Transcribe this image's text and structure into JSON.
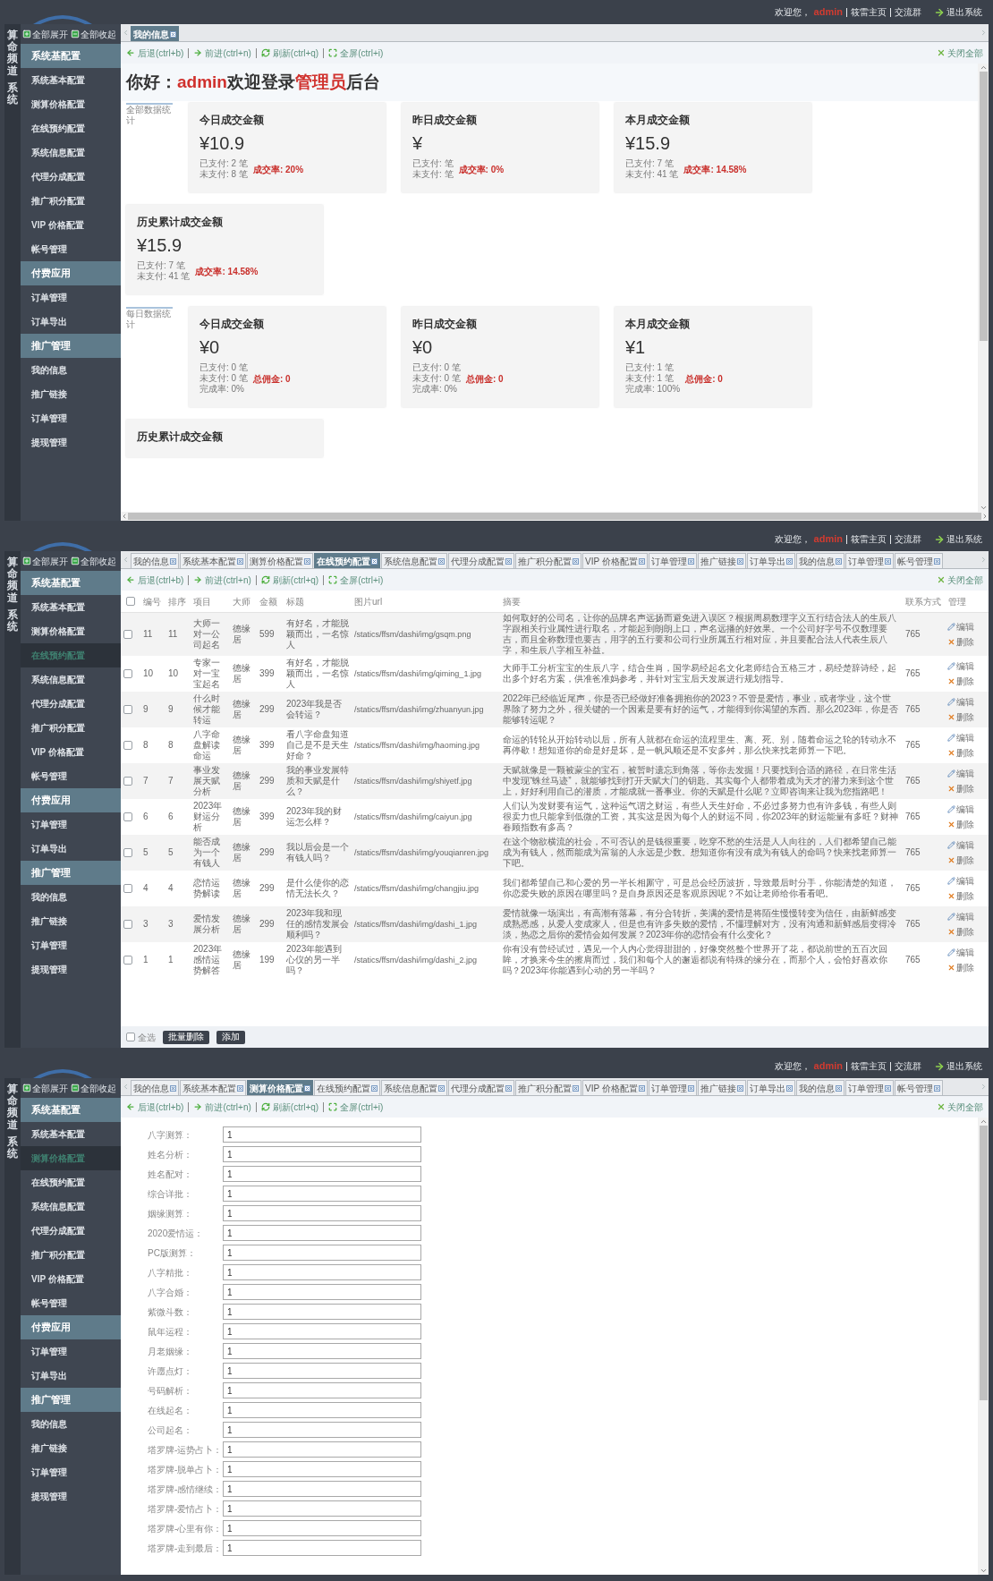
{
  "panels": [
    {
      "header": {
        "welcome": "欢迎您，",
        "user": "admin",
        "links": [
          "筱雷主页",
          "交流群"
        ],
        "logout": "退出系统"
      },
      "brand": [
        "算命频道",
        "系统"
      ],
      "tree_controls": [
        {
          "kind": "expand",
          "label": "全部展开"
        },
        {
          "kind": "collapse",
          "label": "全部收起"
        }
      ],
      "sidebar": [
        {
          "label": "系统基配置",
          "children": [
            {
              "label": "系统基本配置",
              "selected": false
            },
            {
              "label": "测算价格配置",
              "selected": false
            },
            {
              "label": "在线预约配置",
              "selected": false
            },
            {
              "label": "系统信息配置",
              "selected": false
            },
            {
              "label": "代理分成配置",
              "selected": false
            },
            {
              "label": "推广积分配置",
              "selected": false
            },
            {
              "label": "VIP 价格配置",
              "selected": false
            },
            {
              "label": "帐号管理",
              "selected": false
            }
          ]
        },
        {
          "label": "付费应用",
          "children": [
            {
              "label": "订单管理",
              "selected": false
            },
            {
              "label": "订单导出",
              "selected": false
            }
          ]
        },
        {
          "label": "推广管理",
          "children": [
            {
              "label": "我的信息",
              "selected": false
            },
            {
              "label": "推广链接",
              "selected": false
            },
            {
              "label": "订单管理",
              "selected": false
            },
            {
              "label": "提现管理",
              "selected": false
            }
          ]
        }
      ],
      "tabs": [
        {
          "label": "我的信息",
          "selected": true
        }
      ],
      "toolbar": [
        {
          "kind": "back",
          "label": "后退(ctrl+b)"
        },
        {
          "kind": "forward",
          "label": "前进(ctrl+n)"
        },
        {
          "kind": "refresh",
          "label": "刷新(ctrl+q)"
        },
        {
          "kind": "fullscreen",
          "label": "全屏(ctrl+i)"
        }
      ],
      "close_all": "关闭全部",
      "content": {
        "kind": "dashboard",
        "greeting": [
          {
            "text": "你好：",
            "highlight": false
          },
          {
            "text": "admin",
            "highlight": true
          },
          {
            "text": "欢迎登录",
            "highlight": false
          },
          {
            "text": "管理员",
            "highlight": true
          },
          {
            "text": "后台",
            "highlight": false
          }
        ],
        "sections": [
          {
            "label": "全部数据统计",
            "cards": [
              {
                "title": "今日成交金额",
                "amount": "¥10.9",
                "lines": [
                  "已支付: 2 笔",
                  "未支付: 8 笔"
                ],
                "note": "成交率: 20%"
              },
              {
                "title": "昨日成交金额",
                "amount": "¥",
                "lines": [
                  "已支付: 笔",
                  "未支付: 笔"
                ],
                "note": "成交率: 0%"
              },
              {
                "title": "本月成交金额",
                "amount": "¥15.9",
                "lines": [
                  "已支付: 7 笔",
                  "未支付: 41 笔"
                ],
                "note": "成交率: 14.58%"
              },
              {
                "title": "历史累计成交金额",
                "amount": "¥15.9",
                "lines": [
                  "已支付: 7 笔",
                  "未支付: 41 笔"
                ],
                "note": "成交率: 14.58%"
              }
            ]
          },
          {
            "label": "每日数据统计",
            "cards": [
              {
                "title": "今日成交金额",
                "amount": "¥0",
                "lines": [
                  "已支付: 0 笔",
                  "未支付: 0 笔",
                  "完成率: 0%"
                ],
                "note": "总佣金: 0"
              },
              {
                "title": "昨日成交金额",
                "amount": "¥0",
                "lines": [
                  "已支付: 0 笔",
                  "未支付: 0 笔",
                  "完成率: 0%"
                ],
                "note": "总佣金: 0"
              },
              {
                "title": "本月成交金额",
                "amount": "¥1",
                "lines": [
                  "已支付: 1 笔",
                  "未支付: 1 笔",
                  "完成率: 100%"
                ],
                "note": "总佣金: 0"
              },
              {
                "title": "历史累计成交金额"
              }
            ]
          }
        ]
      }
    },
    {
      "header": {
        "welcome": "欢迎您，",
        "user": "admin",
        "links": [
          "筱雷主页",
          "交流群"
        ],
        "logout": "退出系统"
      },
      "brand": [
        "算命频道",
        "系统"
      ],
      "tree_controls": [
        {
          "kind": "expand",
          "label": "全部展开"
        },
        {
          "kind": "collapse",
          "label": "全部收起"
        }
      ],
      "sidebar": [
        {
          "label": "系统基配置",
          "children": [
            {
              "label": "系统基本配置",
              "selected": false
            },
            {
              "label": "测算价格配置",
              "selected": false
            },
            {
              "label": "在线预约配置",
              "selected": true
            },
            {
              "label": "系统信息配置",
              "selected": false
            },
            {
              "label": "代理分成配置",
              "selected": false
            },
            {
              "label": "推广积分配置",
              "selected": false
            },
            {
              "label": "VIP 价格配置",
              "selected": false
            },
            {
              "label": "帐号管理",
              "selected": false
            }
          ]
        },
        {
          "label": "付费应用",
          "children": [
            {
              "label": "订单管理",
              "selected": false
            },
            {
              "label": "订单导出",
              "selected": false
            }
          ]
        },
        {
          "label": "推广管理",
          "children": [
            {
              "label": "我的信息",
              "selected": false
            },
            {
              "label": "推广链接",
              "selected": false
            },
            {
              "label": "订单管理",
              "selected": false
            },
            {
              "label": "提现管理",
              "selected": false
            }
          ]
        }
      ],
      "tabs": [
        {
          "label": "我的信息",
          "selected": false
        },
        {
          "label": "系统基本配置",
          "selected": false
        },
        {
          "label": "测算价格配置",
          "selected": false
        },
        {
          "label": "在线预约配置",
          "selected": true
        },
        {
          "label": "系统信息配置",
          "selected": false
        },
        {
          "label": "代理分成配置",
          "selected": false
        },
        {
          "label": "推广积分配置",
          "selected": false
        },
        {
          "label": "VIP 价格配置",
          "selected": false
        },
        {
          "label": "订单管理",
          "selected": false
        },
        {
          "label": "推广链接",
          "selected": false
        },
        {
          "label": "订单导出",
          "selected": false
        },
        {
          "label": "我的信息",
          "selected": false
        },
        {
          "label": "订单管理",
          "selected": false
        },
        {
          "label": "帐号管理",
          "selected": false
        }
      ],
      "toolbar": [
        {
          "kind": "back",
          "label": "后退(ctrl+b)"
        },
        {
          "kind": "forward",
          "label": "前进(ctrl+n)"
        },
        {
          "kind": "refresh",
          "label": "刷新(ctrl+q)"
        },
        {
          "kind": "fullscreen",
          "label": "全屏(ctrl+i)"
        }
      ],
      "close_all": "关闭全部",
      "content": {
        "kind": "table",
        "header_checked": false,
        "columns": [
          "编号",
          "排序",
          "项目",
          "大师",
          "金额",
          "标题",
          "图片url",
          "摘要",
          "联系方式",
          "管理"
        ],
        "rows": [
          {
            "checked": false,
            "id": "11",
            "order": "11",
            "project": "大师一对一公司起名",
            "master": "德缘居",
            "price": "599",
            "title": "有好名，才能脱颖而出，一名惊人",
            "image_url": "/statics/ffsm/dashi/img/gsqm.png",
            "summary": "如何取好的公司名，让你的品牌名声远扬而避免进入误区？根据周易数理字义五行结合法人的生辰八字跟相关行业属性进行取名，才能起到朗朗上口，声名远播的好效果。一个公司好字号不仅数理要吉，而且全称数理也要吉，用字的五行要和公司行业所属五行相对应，并且要配合法人代表生辰八字，和生辰八字相互补益。",
            "contact": "765",
            "actions": [
              "编辑",
              "删除"
            ]
          },
          {
            "checked": false,
            "id": "10",
            "order": "10",
            "project": "专家一对一宝宝起名",
            "master": "德缘居",
            "price": "399",
            "title": "有好名，才能脱颖而出，一名惊人",
            "image_url": "/statics/ffsm/dashi/img/qiming_1.jpg",
            "summary": "大师手工分析宝宝的生辰八字，结合生肖，国学易经起名文化老师结合五格三才，易经楚辞诗经，起出多个好名方案，供准爸准妈参考，并针对宝宝后天发展进行规划指导。",
            "contact": "765",
            "actions": [
              "编辑",
              "删除"
            ]
          },
          {
            "checked": false,
            "id": "9",
            "order": "9",
            "project": "什么时候才能转运",
            "master": "德缘居",
            "price": "299",
            "title": "2023年我是否会转运？",
            "image_url": "/statics/ffsm/dashi/img/zhuanyun.jpg",
            "summary": "2022年已经临近尾声，你是否已经做好准备拥抱你的2023？不管是爱情，事业，或者学业，这个世界除了努力之外，很关键的一个因素是要有好的运气，才能得到你渴望的东西。那么2023年，你是否能够转运呢？",
            "contact": "765",
            "actions": [
              "编辑",
              "删除"
            ]
          },
          {
            "checked": false,
            "id": "8",
            "order": "8",
            "project": "八字命盘解读命运",
            "master": "德缘居",
            "price": "399",
            "title": "看八字命盘知道自己是不是天生好命？",
            "image_url": "/statics/ffsm/dashi/img/haoming.jpg",
            "summary": "命运的转轮从开始转动以后，所有人就都在命运的流程里生、离、死、别，随着命运之轮的转动永不再停歇！想知道你的命是好是坏，是一帆风顺还是不安多舛，那么快来找老师算一下吧。",
            "contact": "765",
            "actions": [
              "编辑",
              "删除"
            ]
          },
          {
            "checked": false,
            "id": "7",
            "order": "7",
            "project": "事业发展天赋分析",
            "master": "德缘居",
            "price": "299",
            "title": "我的事业发展特质和天赋是什么？",
            "image_url": "/statics/ffsm/dashi/img/shiyetf.jpg",
            "summary": "天赋就像是一颗被蒙尘的宝石，被暂时遗忘到角落，等你去发掘！只要找到合适的路径，在日常生活中发现“蛛丝马迹”，就能够找到打开天赋大门的钥匙。其实每个人都带着成为天才的潜力来到这个世上，好好利用自己的潜质，才能成就一番事业。你的天赋是什么呢？立即咨询来让我为您指路吧！",
            "contact": "765",
            "actions": [
              "编辑",
              "删除"
            ]
          },
          {
            "checked": false,
            "id": "6",
            "order": "6",
            "project": "2023年财运分析",
            "master": "德缘居",
            "price": "399",
            "title": "2023年我的财运怎么样？",
            "image_url": "/statics/ffsm/dashi/img/caiyun.jpg",
            "summary": "人们认为发财要有运气，这种运气谓之财运，有些人天生好命，不必过多努力也有许多钱，有些人则很卖力也只能拿到低微的工资，其实这是因为每个人的财运不同，你2023年的财运能量有多旺？财神眷顾指数有多高？",
            "contact": "765",
            "actions": [
              "编辑",
              "删除"
            ]
          },
          {
            "checked": false,
            "id": "5",
            "order": "5",
            "project": "能否成为一个有钱人",
            "master": "德缘居",
            "price": "299",
            "title": "我以后会是一个有钱人吗？",
            "image_url": "/statics/ffsm/dashi/img/youqianren.jpg",
            "summary": "在这个物欲横流的社会，不可否认的是钱很重要，吃穿不愁的生活是人人向往的，人们都希望自己能成为有钱人，然而能成为富翁的人永远是少数。想知道你有没有成为有钱人的命吗？快来找老师算一下吧。",
            "contact": "765",
            "actions": [
              "编辑",
              "删除"
            ]
          },
          {
            "checked": false,
            "id": "4",
            "order": "4",
            "project": "恋情运势解读",
            "master": "德缘居",
            "price": "299",
            "title": "是什么使你的恋情无法长久？",
            "image_url": "/statics/ffsm/dashi/img/changjiu.jpg",
            "summary": "我们都希望自己和心爱的另一半长相厮守，可是总会经历波折，导致最后时分手，你能清楚的知道，你恋爱失败的原因在哪里吗？是自身原因还是客观原因呢？不如让老师给你看看吧。",
            "contact": "765",
            "actions": [
              "编辑",
              "删除"
            ]
          },
          {
            "checked": false,
            "id": "3",
            "order": "3",
            "project": "爱情发展分析",
            "master": "德缘居",
            "price": "299",
            "title": "2023年我和现任的感情发展会顺利吗？",
            "image_url": "/statics/ffsm/dashi/img/dashi_1.jpg",
            "summary": "爱情就像一场演出，有高潮有落幕，有分合转折，美满的爱情是将陌生慢慢转变为信任，由新鲜感变成熟悉感，从爱人变成家人，但是也有许多失败的爱情，不懂理解对方，没有沟通和新鲜感后变得冷淡，热恋之后你的爱情会如何发展？2023年你的恋情会有什么变化？",
            "contact": "765",
            "actions": [
              "编辑",
              "删除"
            ]
          },
          {
            "checked": false,
            "id": "1",
            "order": "1",
            "project": "2023年感情运势解答",
            "master": "德缘居",
            "price": "199",
            "title": "2023年能遇到心仪的另一半吗？",
            "image_url": "/statics/ffsm/dashi/img/dashi_2.jpg",
            "summary": "你有没有曾经试过，遇见一个人内心觉得甜甜的，好像突然整个世界开了花，都说前世的五百次回眸，才换来今生的擦肩而过，我们和每个人的邂逅都说有特殊的缘分在，而那个人，会恰好喜欢你吗？2023年你能遇到心动的另一半吗？",
            "contact": "765",
            "actions": [
              "编辑",
              "删除"
            ]
          }
        ],
        "footer": {
          "select_all": {
            "label": "全选",
            "checked": false
          },
          "buttons": [
            "批量删除",
            "添加"
          ]
        }
      }
    },
    {
      "header": {
        "welcome": "欢迎您，",
        "user": "admin",
        "links": [
          "筱雷主页",
          "交流群"
        ],
        "logout": "退出系统"
      },
      "brand": [
        "算命频道",
        "系统"
      ],
      "tree_controls": [
        {
          "kind": "expand",
          "label": "全部展开"
        },
        {
          "kind": "collapse",
          "label": "全部收起"
        }
      ],
      "sidebar": [
        {
          "label": "系统基配置",
          "children": [
            {
              "label": "系统基本配置",
              "selected": false
            },
            {
              "label": "测算价格配置",
              "selected": true
            },
            {
              "label": "在线预约配置",
              "selected": false
            },
            {
              "label": "系统信息配置",
              "selected": false
            },
            {
              "label": "代理分成配置",
              "selected": false
            },
            {
              "label": "推广积分配置",
              "selected": false
            },
            {
              "label": "VIP 价格配置",
              "selected": false
            },
            {
              "label": "帐号管理",
              "selected": false
            }
          ]
        },
        {
          "label": "付费应用",
          "children": [
            {
              "label": "订单管理",
              "selected": false
            },
            {
              "label": "订单导出",
              "selected": false
            }
          ]
        },
        {
          "label": "推广管理",
          "children": [
            {
              "label": "我的信息",
              "selected": false
            },
            {
              "label": "推广链接",
              "selected": false
            },
            {
              "label": "订单管理",
              "selected": false
            },
            {
              "label": "提现管理",
              "selected": false
            }
          ]
        }
      ],
      "tabs": [
        {
          "label": "我的信息",
          "selected": false
        },
        {
          "label": "系统基本配置",
          "selected": false
        },
        {
          "label": "测算价格配置",
          "selected": true
        },
        {
          "label": "在线预约配置",
          "selected": false
        },
        {
          "label": "系统信息配置",
          "selected": false
        },
        {
          "label": "代理分成配置",
          "selected": false
        },
        {
          "label": "推广积分配置",
          "selected": false
        },
        {
          "label": "VIP 价格配置",
          "selected": false
        },
        {
          "label": "订单管理",
          "selected": false
        },
        {
          "label": "推广链接",
          "selected": false
        },
        {
          "label": "订单导出",
          "selected": false
        },
        {
          "label": "我的信息",
          "selected": false
        },
        {
          "label": "订单管理",
          "selected": false
        },
        {
          "label": "帐号管理",
          "selected": false
        }
      ],
      "toolbar": [
        {
          "kind": "back",
          "label": "后退(ctrl+b)"
        },
        {
          "kind": "forward",
          "label": "前进(ctrl+n)"
        },
        {
          "kind": "refresh",
          "label": "刷新(ctrl+q)"
        },
        {
          "kind": "fullscreen",
          "label": "全屏(ctrl+i)"
        }
      ],
      "close_all": "关闭全部",
      "content": {
        "kind": "form",
        "fields": [
          {
            "label": "八字测算：",
            "value": "1"
          },
          {
            "label": "姓名分析：",
            "value": "1"
          },
          {
            "label": "姓名配对：",
            "value": "1"
          },
          {
            "label": "综合详批：",
            "value": "1"
          },
          {
            "label": "姻缘测算：",
            "value": "1"
          },
          {
            "label": "2020爱情运：",
            "value": "1"
          },
          {
            "label": "PC版测算：",
            "value": "1"
          },
          {
            "label": "八字精批：",
            "value": "1"
          },
          {
            "label": "八字合婚：",
            "value": "1"
          },
          {
            "label": "紫微斗数：",
            "value": "1"
          },
          {
            "label": "鼠年运程：",
            "value": "1"
          },
          {
            "label": "月老姻缘：",
            "value": "1"
          },
          {
            "label": "许愿点灯：",
            "value": "1"
          },
          {
            "label": "号码解析：",
            "value": "1"
          },
          {
            "label": "在线起名：",
            "value": "1"
          },
          {
            "label": "公司起名：",
            "value": "1"
          },
          {
            "label": "塔罗牌-运势占卜：",
            "value": "1"
          },
          {
            "label": "塔罗牌-脱单占卜：",
            "value": "1"
          },
          {
            "label": "塔罗牌-感情继续：",
            "value": "1"
          },
          {
            "label": "塔罗牌-爱情占卜：",
            "value": "1"
          },
          {
            "label": "塔罗牌-心里有你：",
            "value": "1"
          },
          {
            "label": "塔罗牌-走到最后：",
            "value": "1"
          }
        ]
      }
    }
  ]
}
